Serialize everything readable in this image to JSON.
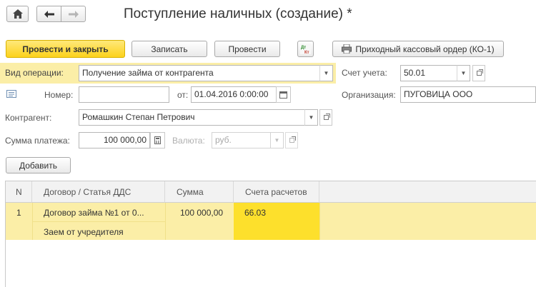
{
  "title": "Поступление наличных (создание) *",
  "toolbar": {
    "post_and_close": "Провести и закрыть",
    "save": "Записать",
    "post": "Провести",
    "dt_kt_label": "Дт Кт",
    "print_order": "Приходный кассовый ордер (КО-1)"
  },
  "form": {
    "operation_type_label": "Вид операции:",
    "operation_type_value": "Получение займа от контрагента",
    "account_label": "Счет учета:",
    "account_value": "50.01",
    "number_label": "Номер:",
    "number_value": "",
    "from_label": "от:",
    "date_value": "01.04.2016  0:00:00",
    "organization_label": "Организация:",
    "organization_value": "ПУГОВИЦА ООО",
    "counterparty_label": "Контрагент:",
    "counterparty_value": "Ромашкин Степан Петрович",
    "amount_label": "Сумма платежа:",
    "amount_value": "100 000,00",
    "currency_label": "Валюта:",
    "currency_value": "руб."
  },
  "add_button": "Добавить",
  "table": {
    "columns": [
      "N",
      "Договор / Статья ДДС",
      "Сумма",
      "Счета расчетов"
    ],
    "rows": [
      {
        "n": "1",
        "contract": "Договор займа №1 от 0...",
        "article": "Заем от учредителя",
        "amount": "100 000,00",
        "account": "66.03"
      }
    ]
  },
  "colors": {
    "primary_button": "#fcd21c",
    "highlight_field": "#fbeea7",
    "selected_row": "#fbeea7",
    "active_cell": "#fde02c"
  }
}
